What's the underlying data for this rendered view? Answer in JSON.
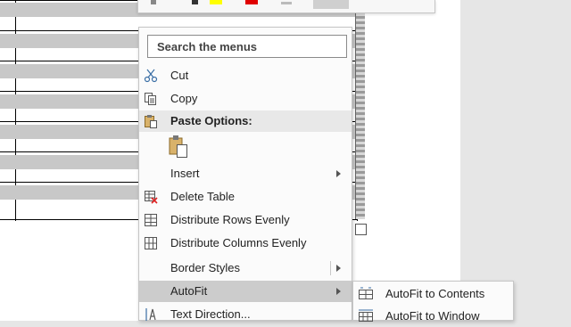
{
  "search": {
    "placeholder": "Search the menus"
  },
  "menu": {
    "cut": "Cut",
    "copy": "Copy",
    "paste_options": "Paste Options:",
    "insert": "Insert",
    "delete_table": "Delete Table",
    "distribute_rows": "Distribute Rows Evenly",
    "distribute_columns": "Distribute Columns Evenly",
    "border_styles": "Border Styles",
    "autofit": "AutoFit",
    "text_direction": "Text Direction..."
  },
  "submenu": {
    "autofit_contents": "AutoFit to Contents",
    "autofit_window": "AutoFit to Window"
  },
  "toolbar": {
    "highlight_color": "#ffff00",
    "font_color": "#e00000"
  },
  "icons": {
    "cut": "scissors-icon",
    "copy": "copy-icon",
    "paste": "clipboard-icon",
    "delete_table": "delete-table-icon",
    "distribute_rows": "distribute-rows-icon",
    "distribute_columns": "distribute-columns-icon",
    "text_direction": "text-direction-icon"
  }
}
